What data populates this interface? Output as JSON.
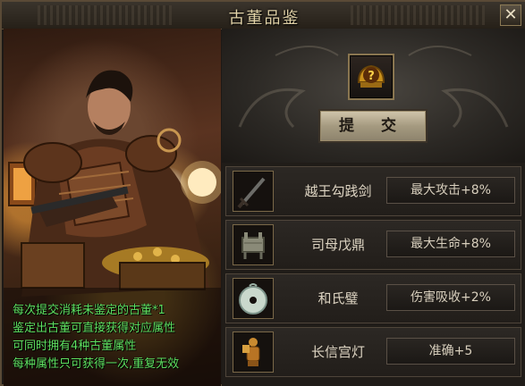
{
  "window": {
    "title": "古董品鉴",
    "close_label": "✕"
  },
  "submit": {
    "label": "提 交",
    "slot_mark": "?"
  },
  "description": {
    "lines": [
      "每次提交消耗未鉴定的古董*1",
      "鉴定出古董可直接获得对应属性",
      "可同时拥有4种古董属性",
      "每种属性只可获得一次,重复无效"
    ]
  },
  "items": [
    {
      "name": "越王勾践剑",
      "attribute": "最大攻击+8%",
      "icon": "sword-icon"
    },
    {
      "name": "司母戊鼎",
      "attribute": "最大生命+8%",
      "icon": "cauldron-icon"
    },
    {
      "name": "和氏璧",
      "attribute": "伤害吸收+2%",
      "icon": "jade-disc-icon"
    },
    {
      "name": "长信宫灯",
      "attribute": "准确+5",
      "icon": "palace-lamp-icon"
    }
  ],
  "colors": {
    "desc_text": "#5fe060",
    "frame_gold": "#8a7650",
    "button_face": "#bcb195"
  }
}
